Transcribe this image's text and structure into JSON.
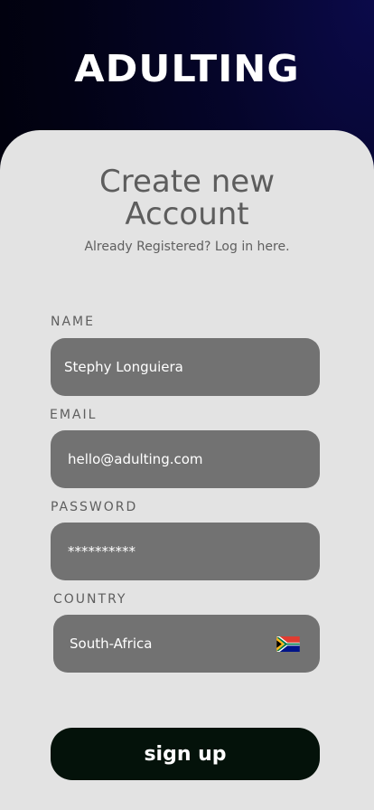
{
  "app": {
    "brand": "ADULTING"
  },
  "header": {
    "title_line1": "Create new",
    "title_line2": "Account",
    "login_prompt": "Already Registered? Log in here."
  },
  "form": {
    "name": {
      "label": "NAME",
      "value": "Stephy Longuiera"
    },
    "email": {
      "label": "EMAIL",
      "value": "hello@adulting.com"
    },
    "password": {
      "label": "PASSWORD",
      "value": "**********"
    },
    "country": {
      "label": "COUNTRY",
      "value": "South-Africa",
      "flag_icon": "south-africa-flag-icon"
    },
    "submit_label": "sign up"
  },
  "colors": {
    "card_bg": "#e3e3e3",
    "field_bg": "#727272",
    "button_bg": "#04120a",
    "text_muted": "#5d5d5d"
  }
}
